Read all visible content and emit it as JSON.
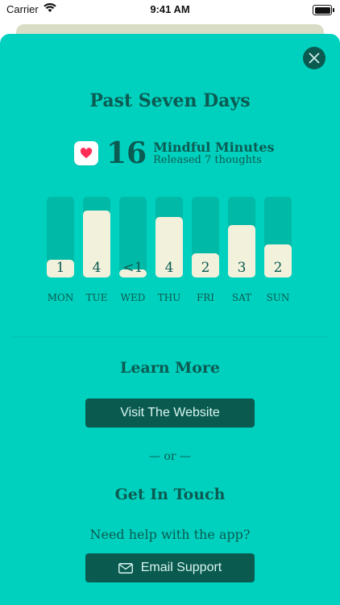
{
  "status_bar": {
    "carrier": "Carrier",
    "time": "9:41 AM",
    "wifi_icon": "wifi-icon",
    "battery_icon": "battery-icon"
  },
  "sheet": {
    "title": "Past Seven Days",
    "summary": {
      "minutes": "16",
      "minutes_label": "Mindful Minutes",
      "released": "Released 7 thoughts",
      "health_icon": "heart-icon"
    },
    "chart_data": {
      "type": "bar",
      "categories": [
        "MON",
        "TUE",
        "WED",
        "THU",
        "FRI",
        "SAT",
        "SUN"
      ],
      "values": [
        1,
        4,
        0.5,
        4,
        2,
        3,
        2
      ],
      "value_labels": [
        "1",
        "4",
        "<1",
        "4",
        "2",
        "3",
        "2"
      ],
      "fill_fractions": [
        0.22,
        0.83,
        0.1,
        0.75,
        0.3,
        0.65,
        0.41
      ]
    },
    "learn_more": {
      "title": "Learn More",
      "button": "Visit The Website"
    },
    "or_text": "— or —",
    "get_in_touch": {
      "title": "Get In Touch",
      "help": "Need help with the app?",
      "button": "Email Support",
      "button_icon": "envelope-icon"
    },
    "close_icon": "close-icon",
    "colors": {
      "background": "#00d1be",
      "dark": "#0a5a50",
      "track": "#00b9a6",
      "bar_fill": "#f2f1db",
      "text": "#0b5b52"
    }
  }
}
